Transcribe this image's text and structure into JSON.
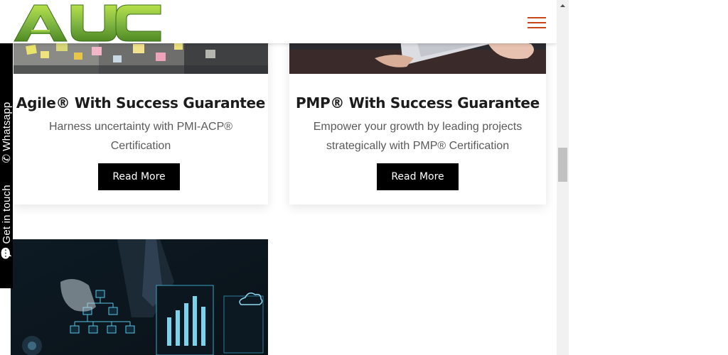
{
  "brand": {
    "logo_text": "AUC",
    "logo_color": "#7cb342"
  },
  "header": {
    "menu_icon": "hamburger-menu-icon",
    "menu_color": "#c8471b"
  },
  "side_tab": {
    "whatsapp_label": "Whatsapp",
    "contact_label": "Get in touch",
    "whatsapp_icon": "whatsapp-icon",
    "contact_icon": "chat-icon"
  },
  "cards": [
    {
      "title": "Agile® With Success Guarantee",
      "description": "Harness uncertainty with PMI-ACP® Certification",
      "button_label": "Read More"
    },
    {
      "title": "PMP® With Success Guarantee",
      "description": "Empower your growth by leading projects strategically with PMP® Certification",
      "button_label": "Read More"
    }
  ],
  "colors": {
    "button_bg": "#000000",
    "title": "#1c1c1c",
    "text": "#5a5a5a"
  }
}
